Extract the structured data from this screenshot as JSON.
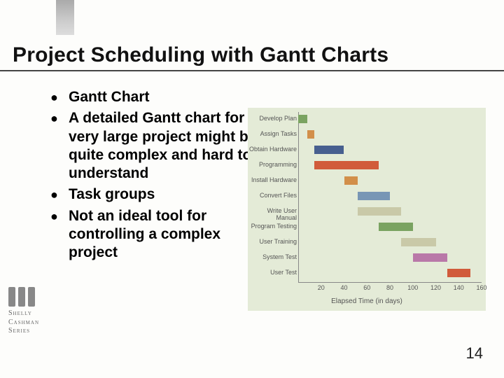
{
  "title": "Project Scheduling with Gantt Charts",
  "bullets": [
    {
      "text": "Gantt Chart",
      "highlight": true
    },
    {
      "text": "A detailed Gantt chart for a very large project might be quite complex and hard to understand",
      "highlight": false
    },
    {
      "text": "Task groups",
      "highlight": true
    },
    {
      "text": "Not an ideal tool for controlling a complex project",
      "highlight": false
    }
  ],
  "logo": {
    "line1": "Shelly",
    "line2": "Cashman",
    "line3": "Series"
  },
  "page_number": "14",
  "chart_data": {
    "type": "bar",
    "title": "",
    "xlabel": "Elapsed Time (in days)",
    "ylabel": "",
    "xlim": [
      0,
      160
    ],
    "x_ticks": [
      20,
      40,
      60,
      80,
      100,
      120,
      140,
      160
    ],
    "tasks": [
      {
        "name": "Develop Plan",
        "start": 0,
        "end": 8,
        "color": "#7aa361"
      },
      {
        "name": "Assign Tasks",
        "start": 8,
        "end": 14,
        "color": "#d28f4a"
      },
      {
        "name": "Obtain Hardware",
        "start": 14,
        "end": 40,
        "color": "#475f8f"
      },
      {
        "name": "Programming",
        "start": 14,
        "end": 70,
        "color": "#d15b3b"
      },
      {
        "name": "Install Hardware",
        "start": 40,
        "end": 52,
        "color": "#d28f4a"
      },
      {
        "name": "Convert Files",
        "start": 52,
        "end": 80,
        "color": "#7896b5"
      },
      {
        "name": "Write User Manual",
        "start": 52,
        "end": 90,
        "color": "#c9c9a8"
      },
      {
        "name": "Program Testing",
        "start": 70,
        "end": 100,
        "color": "#7aa361"
      },
      {
        "name": "User Training",
        "start": 90,
        "end": 120,
        "color": "#c9c9a8"
      },
      {
        "name": "System Test",
        "start": 100,
        "end": 130,
        "color": "#b978a8"
      },
      {
        "name": "User Test",
        "start": 130,
        "end": 150,
        "color": "#d15b3b"
      }
    ]
  }
}
